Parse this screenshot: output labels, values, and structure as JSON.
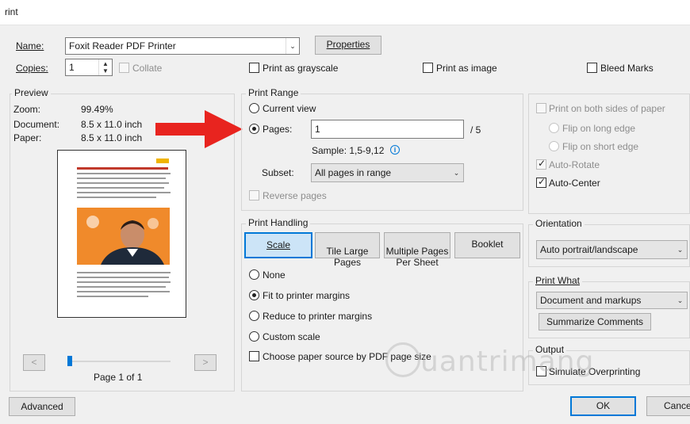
{
  "window": {
    "title": "rint"
  },
  "printer": {
    "name_label": "Name:",
    "name_value": "Foxit Reader PDF Printer",
    "properties_button": "Properties"
  },
  "copies": {
    "label": "Copies:",
    "value": "1",
    "collate_label": "Collate"
  },
  "options_row": {
    "grayscale_label": "Print as grayscale",
    "image_label": "Print as image",
    "bleed_label": "Bleed Marks"
  },
  "preview": {
    "group_title": "Preview",
    "zoom_label": "Zoom:",
    "zoom_value": "99.49%",
    "document_label": "Document:",
    "document_value": "8.5 x 11.0 inch",
    "paper_label": "Paper:",
    "paper_value": "8.5 x 11.0 inch",
    "prev_button": "<",
    "next_button": ">",
    "page_indicator": "Page 1 of 1",
    "slider_position": 0
  },
  "print_range": {
    "group_title": "Print Range",
    "current_view_label": "Current view",
    "pages_label": "Pages:",
    "pages_value": "1",
    "total_pages": "/ 5",
    "sample_text": "Sample: 1,5-9,12",
    "info_icon": "info-icon",
    "subset_label": "Subset:",
    "subset_value": "All pages in range",
    "reverse_label": "Reverse pages"
  },
  "print_handling": {
    "group_title": "Print Handling",
    "tabs": [
      {
        "label": "Scale"
      },
      {
        "label": "Tile Large\nPages"
      },
      {
        "label": "Multiple Pages\nPer Sheet"
      },
      {
        "label": "Booklet"
      }
    ],
    "none_label": "None",
    "fit_label": "Fit to printer margins",
    "reduce_label": "Reduce to printer margins",
    "custom_label": "Custom scale",
    "paper_source_label": "Choose paper source by PDF page size"
  },
  "duplex": {
    "both_sides_label": "Print on both sides of paper",
    "long_edge_label": "Flip on long edge",
    "short_edge_label": "Flip on short edge",
    "auto_rotate_label": "Auto-Rotate",
    "auto_center_label": "Auto-Center"
  },
  "orientation": {
    "group_title": "Orientation",
    "value": "Auto portrait/landscape"
  },
  "print_what": {
    "group_title": "Print What",
    "value": "Document and markups",
    "summarize_button": "Summarize Comments"
  },
  "output": {
    "group_title": "Output",
    "simulate_label": "Simulate Overprinting"
  },
  "footer": {
    "advanced_button": "Advanced",
    "ok_button": "OK",
    "cancel_button": "Cance"
  },
  "watermark": {
    "text": "uantrimang"
  },
  "colors": {
    "accent": "#0078d7",
    "arrow": "#e8241f",
    "photo_bg": "#f08a2b"
  }
}
